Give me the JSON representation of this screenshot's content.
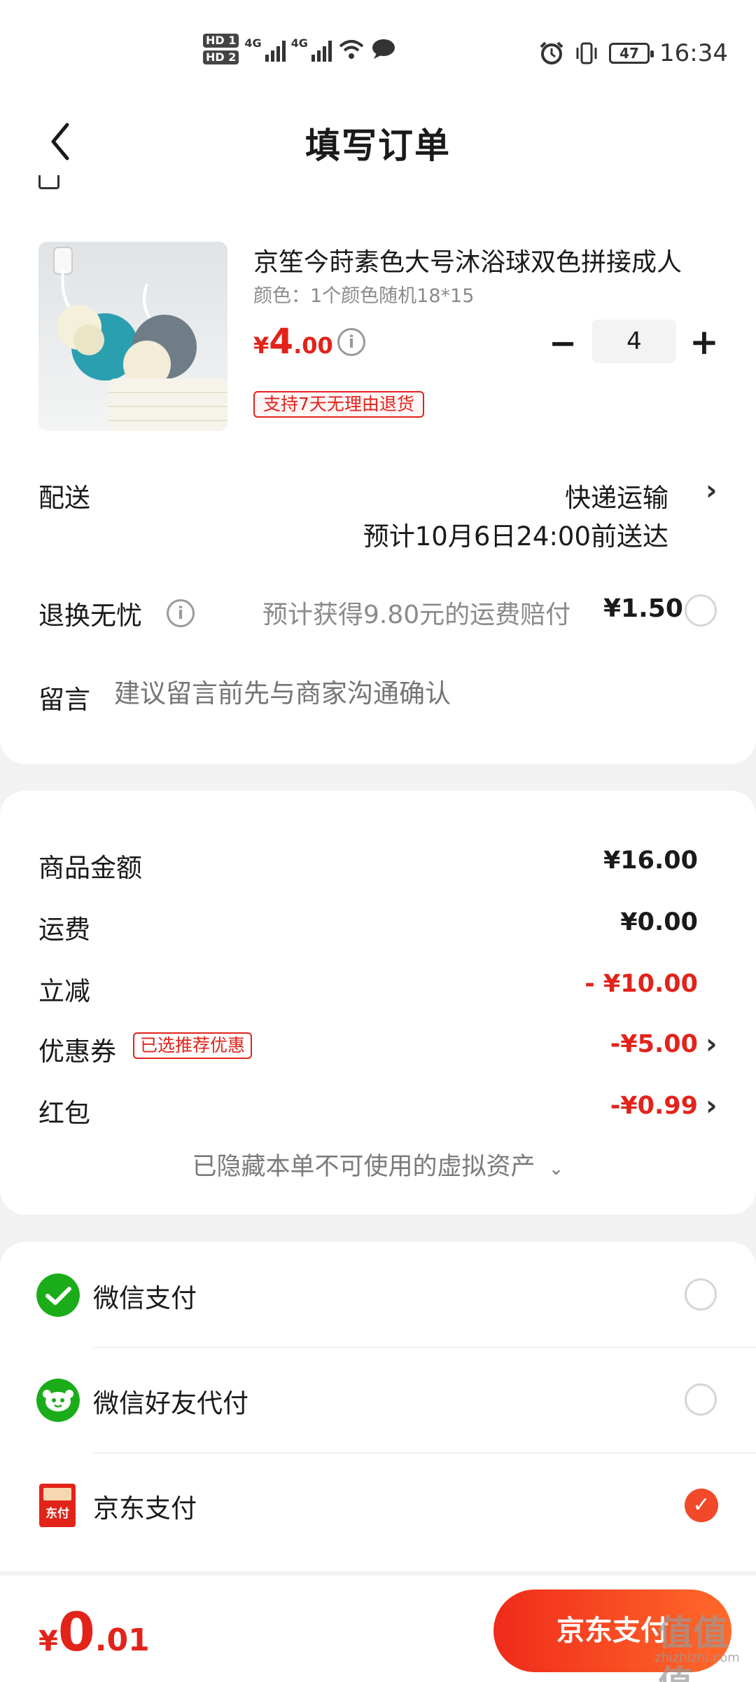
{
  "status_bar": {
    "hd1": "HD 1",
    "hd2": "HD 2",
    "net1": "4G",
    "net2": "4G",
    "battery": "47",
    "time": "16:34"
  },
  "header": {
    "title": "填写订单",
    "back_icon": "chevron-left-icon"
  },
  "product": {
    "name": "京笙今莳素色大号沐浴球双色拼接成人",
    "spec": "颜色：1个颜色随机18*15",
    "price_currency": "¥",
    "price_int": "4",
    "price_dec": ".00",
    "quantity": "4",
    "minus_label": "−",
    "plus_label": "+",
    "return_tag": "支持7天无理由退货",
    "info_icon": "info-icon"
  },
  "delivery": {
    "label": "配送",
    "method": "快递运输",
    "eta": "预计10月6日24:00前送达"
  },
  "return_worry": {
    "label": "退换无忧",
    "desc": "预计获得9.80元的运费赔付",
    "price": "¥1.50",
    "selected": false
  },
  "message": {
    "label": "留言",
    "placeholder": "建议留言前先与商家沟通确认"
  },
  "summary": {
    "goods_label": "商品金额",
    "goods_value": "¥16.00",
    "shipping_label": "运费",
    "shipping_value": "¥0.00",
    "discount_label": "立减",
    "discount_value": "- ¥10.00",
    "coupon_label": "优惠券",
    "coupon_tag": "已选推荐优惠",
    "coupon_value": "-¥5.00",
    "redpacket_label": "红包",
    "redpacket_value": "-¥0.99",
    "hidden_assets": "已隐藏本单不可使用的虚拟资产"
  },
  "payment": {
    "options": [
      {
        "label": "微信支付",
        "icon": "wechat-pay-icon",
        "selected": false
      },
      {
        "label": "微信好友代付",
        "icon": "wechat-friend-pay-icon",
        "selected": false
      },
      {
        "label": "京东支付",
        "icon": "jd-pay-icon",
        "selected": true
      }
    ],
    "jd_icon_text": "东付"
  },
  "footer": {
    "total_currency": "¥",
    "total_int": "0",
    "total_dec": ".01",
    "pay_button": "京东支付",
    "watermark": "zhizhizhi.com",
    "wm_logo": "值值值"
  },
  "colors": {
    "accent": "#e2231a",
    "button_start": "#f02b1b",
    "button_end": "#ff6a2a",
    "wechat_green": "#1aad19"
  }
}
